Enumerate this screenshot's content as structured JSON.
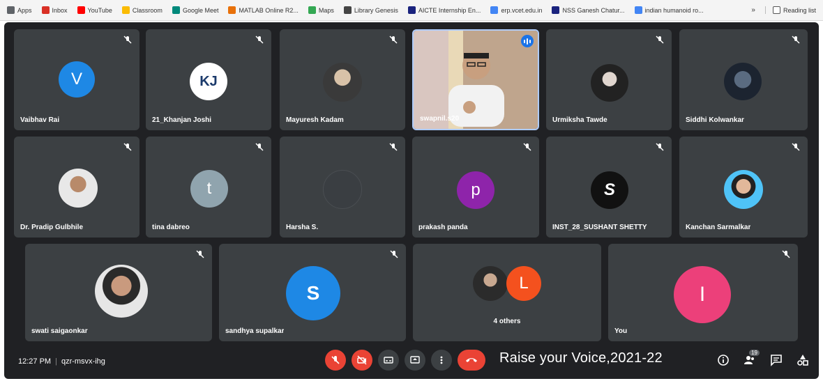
{
  "bookmarks": [
    {
      "label": "Apps",
      "color": "#5f6368"
    },
    {
      "label": "Inbox",
      "color": "#d93025"
    },
    {
      "label": "YouTube",
      "color": "#ff0000"
    },
    {
      "label": "Classroom",
      "color": "#fbbc04"
    },
    {
      "label": "Google Meet",
      "color": "#00897b"
    },
    {
      "label": "MATLAB Online R2...",
      "color": "#e8710a"
    },
    {
      "label": "Maps",
      "color": "#34a853"
    },
    {
      "label": "Library Genesis",
      "color": "#444444"
    },
    {
      "label": "AICTE Internship En...",
      "color": "#1a237e"
    },
    {
      "label": "erp.vcet.edu.in",
      "color": "#4285f4"
    },
    {
      "label": "NSS Ganesh Chatur...",
      "color": "#1a237e"
    },
    {
      "label": "indian humanoid ro...",
      "color": "#4285f4"
    }
  ],
  "reading_list": "Reading list",
  "participants": [
    {
      "name": "Vaibhav Rai",
      "initial": "V",
      "color": "#1e88e5",
      "kind": "letter"
    },
    {
      "name": "21_Khanjan Joshi",
      "initial": "KJ",
      "color": "#ffffff",
      "kind": "logo"
    },
    {
      "name": "Mayuresh Kadam",
      "initial": "",
      "color": "#6d6d6d",
      "kind": "photo"
    },
    {
      "name": "swapnil.s20",
      "initial": "",
      "color": "",
      "kind": "video"
    },
    {
      "name": "Urmiksha Tawde",
      "initial": "",
      "color": "#555555",
      "kind": "photo"
    },
    {
      "name": "Siddhi Kolwankar",
      "initial": "",
      "color": "#2e3b4e",
      "kind": "photo"
    },
    {
      "name": "Dr. Pradip Gulbhile",
      "initial": "",
      "color": "#dddddd",
      "kind": "photo"
    },
    {
      "name": "tina dabreo",
      "initial": "t",
      "color": "#90a4ae",
      "kind": "letter"
    },
    {
      "name": "Harsha S.",
      "initial": "",
      "color": "#3c4043",
      "kind": "photo"
    },
    {
      "name": "prakash panda",
      "initial": "p",
      "color": "#8e24aa",
      "kind": "letter"
    },
    {
      "name": "INST_28_SUSHANT SHETTY",
      "initial": "S",
      "color": "#111111",
      "kind": "logo"
    },
    {
      "name": "Kanchan Sarmalkar",
      "initial": "",
      "color": "#4fc3f7",
      "kind": "photo"
    },
    {
      "name": "swati saigaonkar",
      "initial": "",
      "color": "#dddddd",
      "kind": "photo"
    },
    {
      "name": "sandhya supalkar",
      "initial": "S",
      "color": "#1e88e5",
      "kind": "letter"
    },
    {
      "name": "4 others",
      "initial": "L",
      "color": "#f4511e",
      "kind": "group"
    },
    {
      "name": "You",
      "initial": "I",
      "color": "#ec407a",
      "kind": "letter"
    }
  ],
  "bottom": {
    "time": "12:27 PM",
    "meeting_code": "qzr-msvx-ihg",
    "banner": "Raise your Voice,2021-22",
    "people_count": "19"
  },
  "colors": {
    "stage": "#202124",
    "tile": "#3c4043",
    "danger": "#ea4335",
    "active_border": "#aecbfa"
  }
}
